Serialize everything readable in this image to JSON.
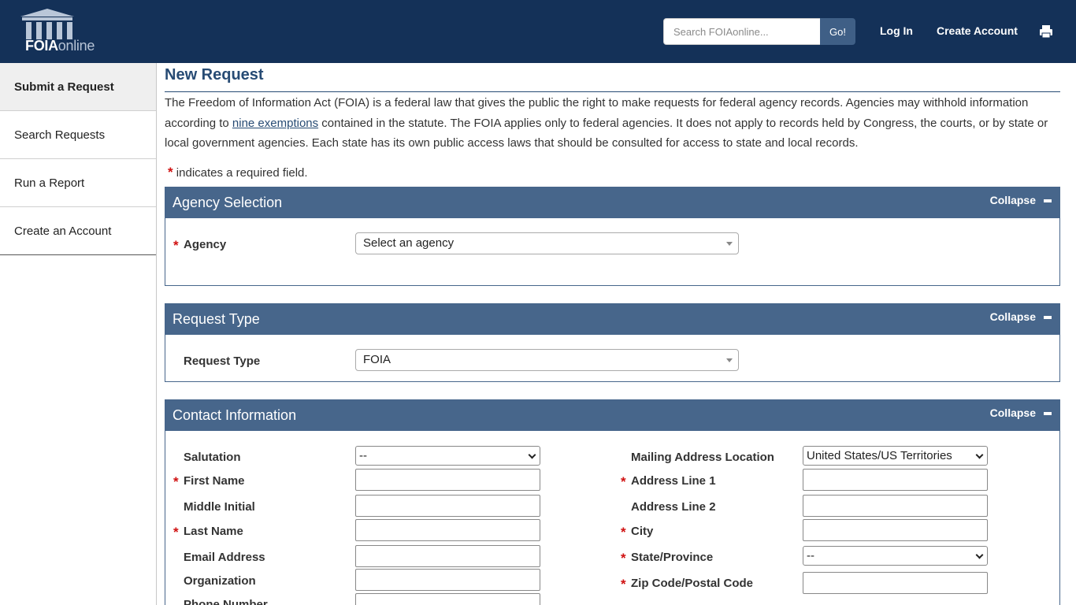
{
  "header": {
    "logo_brand": "FOIA",
    "logo_suffix": "online",
    "search_placeholder": "Search FOIAonline...",
    "go_label": "Go!",
    "login_label": "Log In",
    "create_account_label": "Create Account",
    "print_icon": "print-icon"
  },
  "sidebar": {
    "items": [
      {
        "label": "Submit a Request",
        "active": true
      },
      {
        "label": "Search Requests",
        "active": false
      },
      {
        "label": "Run a Report",
        "active": false
      },
      {
        "label": "Create an Account",
        "active": false
      }
    ]
  },
  "main": {
    "title": "New Request",
    "intro_before": "The Freedom of Information Act (FOIA) is a federal law that gives the public the right to make requests for federal agency records. Agencies may withhold information according to ",
    "intro_link": "nine exemptions",
    "intro_after": " contained in the statute. The FOIA applies only to federal agencies. It does not apply to records held by Congress, the courts, or by state or local government agencies. Each state has its own public access laws that should be consulted for access to state and local records.",
    "required_note": "indicates a required field.",
    "required_marker": "*"
  },
  "panels": {
    "agency": {
      "title": "Agency Selection",
      "collapse_label": "Collapse",
      "agency_label": "Agency",
      "agency_value": "Select an agency"
    },
    "request_type": {
      "title": "Request Type",
      "collapse_label": "Collapse",
      "type_label": "Request Type",
      "type_value": "FOIA"
    },
    "contact": {
      "title": "Contact Information",
      "collapse_label": "Collapse",
      "salutation_label": "Salutation",
      "salutation_value": "--",
      "first_name_label": "First Name",
      "middle_initial_label": "Middle Initial",
      "last_name_label": "Last Name",
      "email_label": "Email Address",
      "organization_label": "Organization",
      "phone_label": "Phone Number",
      "mailing_location_label": "Mailing Address Location",
      "mailing_location_value": "United States/US Territories",
      "address1_label": "Address Line 1",
      "address2_label": "Address Line 2",
      "city_label": "City",
      "state_label": "State/Province",
      "state_value": "--",
      "zip_label": "Zip Code/Postal Code"
    }
  },
  "colors": {
    "header_bg": "#143158",
    "panel_header": "#47668b",
    "title": "#274b74",
    "required": "#d01010"
  }
}
